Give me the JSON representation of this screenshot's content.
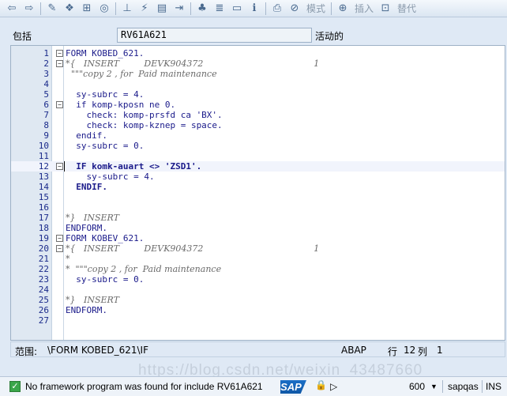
{
  "toolbar": {
    "icons": [
      "back-arrow",
      "forward-arrow",
      "edit-pencil",
      "objects",
      "display",
      "where-used",
      "activate",
      "hierarchy",
      "window",
      "navigate",
      "tree",
      "stack",
      "info",
      "print",
      "check"
    ],
    "mode_label": "模式",
    "insert_label": "插入",
    "replace_label": "替代"
  },
  "program": {
    "label": "包括",
    "name": "RV61A621",
    "status": "活动的"
  },
  "editor": {
    "lines": [
      {
        "n": "1",
        "fold": "⊟",
        "text": "FORM KOBED_621.",
        "style": "kw"
      },
      {
        "n": "2",
        "fold": "⊟",
        "text": "*{   INSERT         DEVK904372                                        1",
        "style": "cm"
      },
      {
        "n": "3",
        "fold": "",
        "text": "  \"\"\"copy 2 , for  Paid maintenance",
        "style": "cm"
      },
      {
        "n": "4",
        "fold": "",
        "text": "",
        "style": "kw"
      },
      {
        "n": "5",
        "fold": "",
        "text": "  sy-subrc = 4.",
        "style": "kw"
      },
      {
        "n": "6",
        "fold": "⊟",
        "text": "  if komp-kposn ne 0.",
        "style": "kw"
      },
      {
        "n": "7",
        "fold": "",
        "text": "    check: komp-prsfd ca 'BX'.",
        "style": "kw"
      },
      {
        "n": "8",
        "fold": "",
        "text": "    check: komp-kznep = space.",
        "style": "kw"
      },
      {
        "n": "9",
        "fold": "",
        "text": "  endif.",
        "style": "kw"
      },
      {
        "n": "10",
        "fold": "",
        "text": "  sy-subrc = 0.",
        "style": "kw"
      },
      {
        "n": "11",
        "fold": "",
        "text": "",
        "style": "kw"
      },
      {
        "n": "12",
        "fold": "⊟",
        "text": "  IF komk-auart <> 'ZSD1'.",
        "style": "bold"
      },
      {
        "n": "13",
        "fold": "",
        "text": "    sy-subrc = 4.",
        "style": "kw"
      },
      {
        "n": "14",
        "fold": "",
        "text": "  ENDIF.",
        "style": "bold"
      },
      {
        "n": "15",
        "fold": "",
        "text": "",
        "style": "kw"
      },
      {
        "n": "16",
        "fold": "",
        "text": "",
        "style": "kw"
      },
      {
        "n": "17",
        "fold": "",
        "text": "*}   INSERT",
        "style": "cm"
      },
      {
        "n": "18",
        "fold": "",
        "text": "ENDFORM.",
        "style": "kw"
      },
      {
        "n": "19",
        "fold": "⊟",
        "text": "FORM KOBEV_621.",
        "style": "kw"
      },
      {
        "n": "20",
        "fold": "⊟",
        "text": "*{   INSERT         DEVK904372                                        1",
        "style": "cm"
      },
      {
        "n": "21",
        "fold": "",
        "text": "*",
        "style": "cm"
      },
      {
        "n": "22",
        "fold": "",
        "text": "*  \"\"\"copy 2 , for  Paid maintenance",
        "style": "cm"
      },
      {
        "n": "23",
        "fold": "",
        "text": "  sy-subrc = 0.",
        "style": "kw"
      },
      {
        "n": "24",
        "fold": "",
        "text": "",
        "style": "kw"
      },
      {
        "n": "25",
        "fold": "",
        "text": "*}   INSERT",
        "style": "cm"
      },
      {
        "n": "26",
        "fold": "",
        "text": "ENDFORM.",
        "style": "kw"
      },
      {
        "n": "27",
        "fold": "",
        "text": "",
        "style": "kw"
      }
    ]
  },
  "scope": {
    "label": "范围:",
    "path": "\\FORM KOBED_621\\IF",
    "language": "ABAP",
    "row_label": "行",
    "row": "12",
    "col_label": "列",
    "col": "1"
  },
  "status": {
    "message": "No framework program was found for include RV61A621",
    "logo": "SAP",
    "client": "600",
    "system": "sapqas",
    "mode": "INS"
  },
  "watermark": "https://blog.csdn.net/weixin_43487660"
}
